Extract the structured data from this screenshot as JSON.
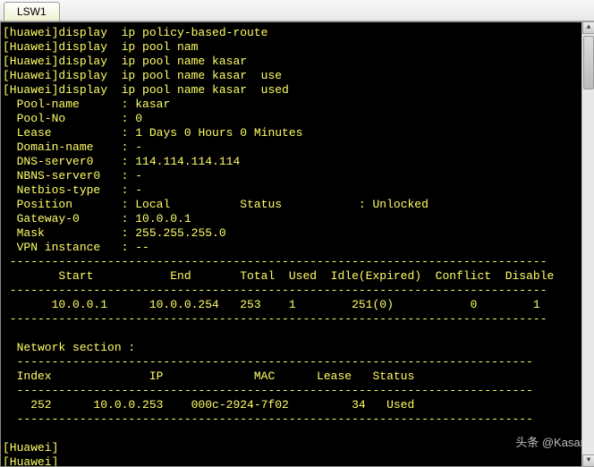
{
  "tab": {
    "label": "LSW1"
  },
  "history": [
    "[huawei]display  ip policy-based-route",
    "[Huawei]display  ip pool nam",
    "[Huawei]display  ip pool name kasar",
    "[Huawei]display  ip pool name kasar  use",
    "[Huawei]display  ip pool name kasar  used"
  ],
  "pool": {
    "name_label": "  Pool-name      : ",
    "name": "kasar",
    "no_label": "  Pool-No        : ",
    "no": "0",
    "lease_label": "  Lease          : ",
    "lease": "1 Days 0 Hours 0 Minutes",
    "domain_label": "  Domain-name    : ",
    "domain": "-",
    "dns_label": "  DNS-server0    : ",
    "dns": "114.114.114.114",
    "nbns_label": "  NBNS-server0   : ",
    "nbns": "-",
    "netbios_label": "  Netbios-type   : ",
    "netbios": "-",
    "position_label": "  Position       : ",
    "position": "Local",
    "status_label": "Status",
    "status": "Unlocked",
    "gateway_label": "  Gateway-0      : ",
    "gateway": "10.0.0.1",
    "mask_label": "  Mask           : ",
    "mask": "255.255.255.0",
    "vpn_label": "  VPN instance   : ",
    "vpn": "--"
  },
  "divider": " -----------------------------------------------------------------------------",
  "table_header": "        Start           End       Total  Used  Idle(Expired)  Conflict  Disable",
  "table_row": "       10.0.0.1      10.0.0.254   253    1        251(0)           0        1",
  "network_section_label": "  Network section : ",
  "net_divider": "  --------------------------------------------------------------------------",
  "net_header": "  Index              IP             MAC      Lease   Status  ",
  "net_row": "    252      10.0.0.253    000c-2924-7f02         34   Used    ",
  "prompt1": "[Huawei]",
  "prompt2": "[Huawei]",
  "watermark": "头条 @Kasar"
}
